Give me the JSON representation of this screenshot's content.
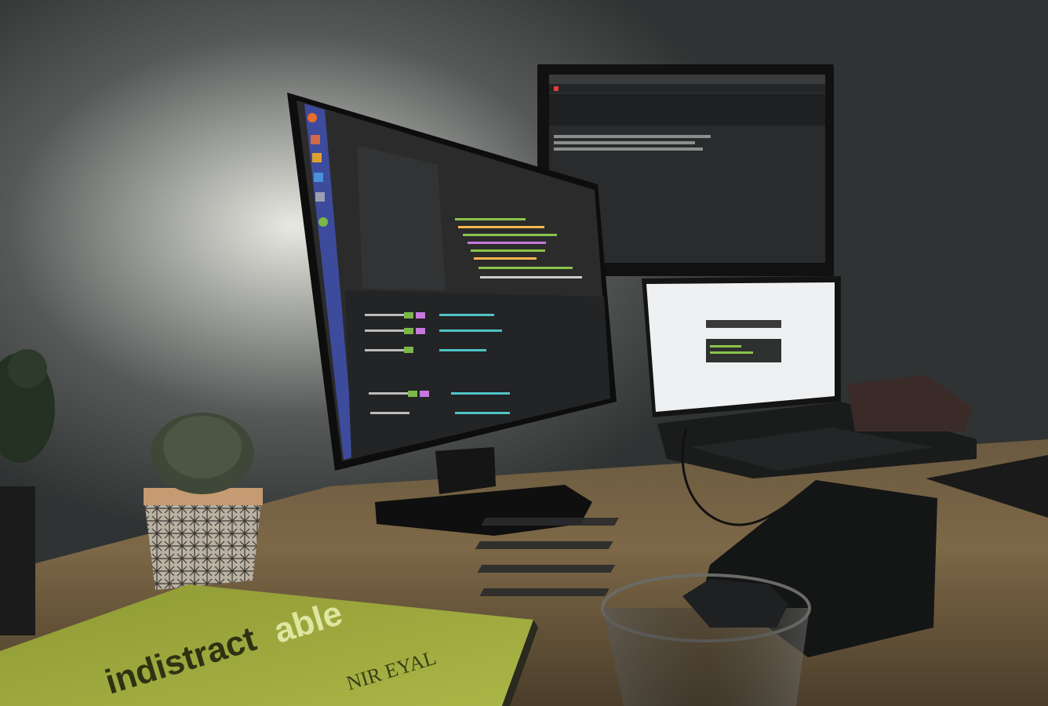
{
  "scene": {
    "description_free": true
  },
  "book": {
    "title_part1": "indistract",
    "title_part2": "able",
    "author": "NIR EYAL"
  },
  "colors": {
    "wall": "#3a3d3d",
    "wall_glow": "#d9d9d2",
    "desk": "#7a6648",
    "monitor_frame": "#111111",
    "ide_bg": "#2b2b2b",
    "ide_code_green": "#8bc34a",
    "ide_code_purple": "#c678dd",
    "ide_code_orange": "#ffb74d",
    "launcher_blue": "#3d4b9c",
    "laptop_screen": "#eef0f2",
    "book_cover": "#9aa53a",
    "cactus": "#3f4838",
    "pot": "#c69a72"
  },
  "icons": {
    "launcher": [
      "ubuntu-icon",
      "files-icon",
      "terminal-icon",
      "browser-icon",
      "settings-icon",
      "code-icon"
    ]
  }
}
